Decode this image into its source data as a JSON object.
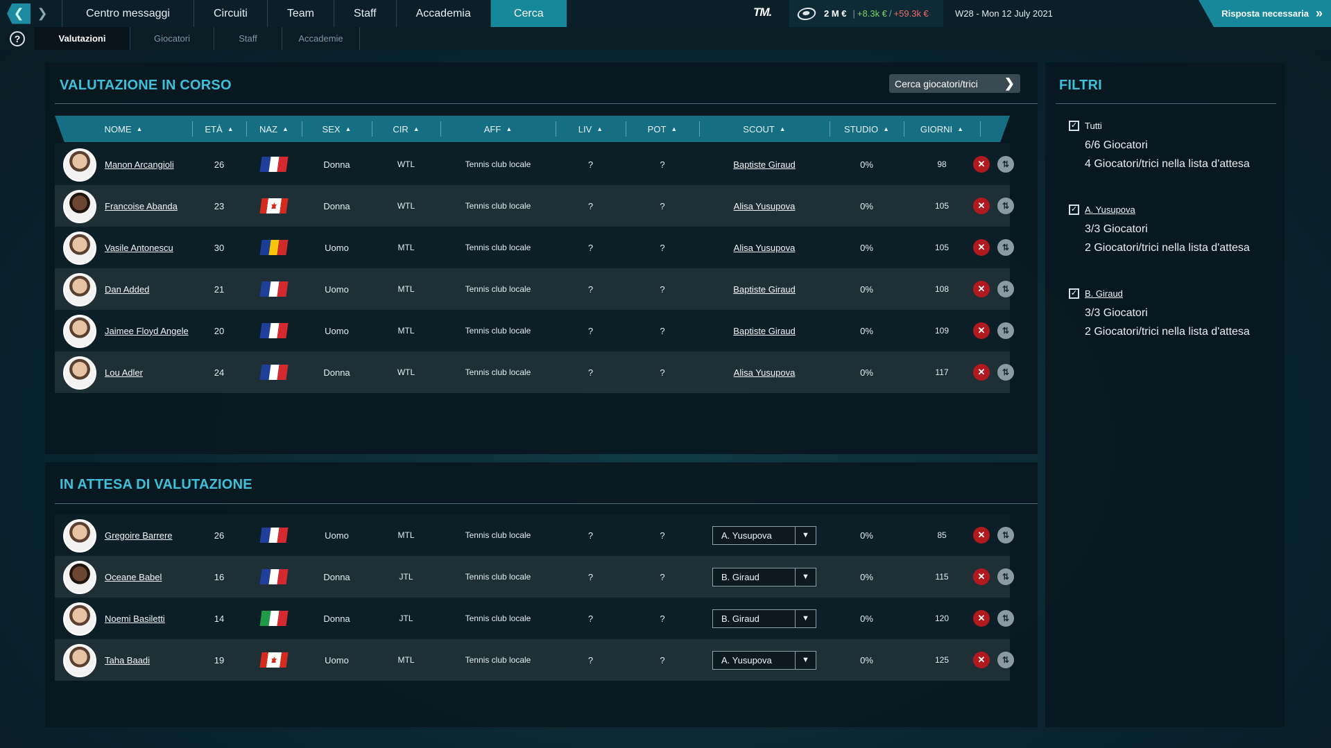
{
  "topbar": {
    "tabs": [
      "Centro messaggi",
      "Circuiti",
      "Team",
      "Staff",
      "Accademia",
      "Cerca"
    ],
    "active_tab": "Cerca",
    "logo": "TM.",
    "money": "2 M €",
    "income": "+8.3k €",
    "sep": "/",
    "expense": "+59.3k €",
    "date": "W28 - Mon 12 July 2021",
    "response_label": "Risposta necessaria"
  },
  "subtabs": [
    "Valutazioni",
    "Giocatori",
    "Staff",
    "Accademie"
  ],
  "current": {
    "title": "VALUTAZIONE IN CORSO",
    "search_button": "Cerca giocatori/trici",
    "headers": [
      "NOME",
      "ETÀ",
      "NAZ",
      "SEX",
      "CIR",
      "AFF",
      "LIV",
      "POT",
      "SCOUT",
      "STUDIO",
      "GIORNI"
    ],
    "rows": [
      {
        "name": "Manon Arcangioli",
        "age": "26",
        "nat": "fr",
        "sex": "Donna",
        "cir": "WTL",
        "aff": "Tennis club locale",
        "liv": "?",
        "pot": "?",
        "scout": "Baptiste Giraud",
        "studio": "0%",
        "giorni": "98"
      },
      {
        "name": "Francoise Abanda",
        "age": "23",
        "nat": "ca",
        "sex": "Donna",
        "cir": "WTL",
        "aff": "Tennis club locale",
        "liv": "?",
        "pot": "?",
        "scout": "Alisa Yusupova",
        "studio": "0%",
        "giorni": "105"
      },
      {
        "name": "Vasile Antonescu",
        "age": "30",
        "nat": "ro",
        "sex": "Uomo",
        "cir": "MTL",
        "aff": "Tennis club locale",
        "liv": "?",
        "pot": "?",
        "scout": "Alisa Yusupova",
        "studio": "0%",
        "giorni": "105"
      },
      {
        "name": "Dan Added",
        "age": "21",
        "nat": "fr",
        "sex": "Uomo",
        "cir": "MTL",
        "aff": "Tennis club locale",
        "liv": "?",
        "pot": "?",
        "scout": "Baptiste Giraud",
        "studio": "0%",
        "giorni": "108"
      },
      {
        "name": "Jaimee Floyd Angele",
        "age": "20",
        "nat": "fr",
        "sex": "Uomo",
        "cir": "MTL",
        "aff": "Tennis club locale",
        "liv": "?",
        "pot": "?",
        "scout": "Baptiste Giraud",
        "studio": "0%",
        "giorni": "109"
      },
      {
        "name": "Lou Adler",
        "age": "24",
        "nat": "fr",
        "sex": "Donna",
        "cir": "WTL",
        "aff": "Tennis club locale",
        "liv": "?",
        "pot": "?",
        "scout": "Alisa Yusupova",
        "studio": "0%",
        "giorni": "117"
      }
    ]
  },
  "pending": {
    "title": "IN ATTESA DI VALUTAZIONE",
    "rows": [
      {
        "name": "Gregoire Barrere",
        "age": "26",
        "nat": "fr",
        "sex": "Uomo",
        "cir": "MTL",
        "aff": "Tennis club locale",
        "liv": "?",
        "pot": "?",
        "scout": "A. Yusupova",
        "studio": "0%",
        "giorni": "85"
      },
      {
        "name": "Oceane Babel",
        "age": "16",
        "nat": "fr",
        "sex": "Donna",
        "cir": "JTL",
        "aff": "Tennis club locale",
        "liv": "?",
        "pot": "?",
        "scout": "B. Giraud",
        "studio": "0%",
        "giorni": "115"
      },
      {
        "name": "Noemi Basiletti",
        "age": "14",
        "nat": "it",
        "sex": "Donna",
        "cir": "JTL",
        "aff": "Tennis club locale",
        "liv": "?",
        "pot": "?",
        "scout": "B. Giraud",
        "studio": "0%",
        "giorni": "120"
      },
      {
        "name": "Taha Baadi",
        "age": "19",
        "nat": "ca",
        "sex": "Uomo",
        "cir": "MTL",
        "aff": "Tennis club locale",
        "liv": "?",
        "pot": "?",
        "scout": "A. Yusupova",
        "studio": "0%",
        "giorni": "125"
      }
    ]
  },
  "filters": {
    "title": "FILTRI",
    "groups": [
      {
        "label": "Tutti",
        "checked": true,
        "lines": [
          "6/6 Giocatori",
          "4 Giocatori/trici nella lista d'attesa"
        ]
      },
      {
        "label": "A. Yusupova",
        "checked": true,
        "lines": [
          "3/3 Giocatori",
          "2 Giocatori/trici nella lista d'attesa"
        ]
      },
      {
        "label": "B. Giraud",
        "checked": true,
        "lines": [
          "3/3 Giocatori",
          "2 Giocatori/trici nella lista d'attesa"
        ]
      }
    ]
  },
  "flags": {
    "fr": [
      "#1f3f9b",
      "#ffffff",
      "#d42a2f"
    ],
    "ro": [
      "#1c3d96",
      "#f6c60d",
      "#cf2a2a"
    ],
    "it": [
      "#1f9a47",
      "#ffffff",
      "#d42a2f"
    ]
  },
  "icons": {
    "remove": "✕",
    "move": "⇅",
    "dropdown": "▼",
    "sort": "▲",
    "check": "✓"
  }
}
